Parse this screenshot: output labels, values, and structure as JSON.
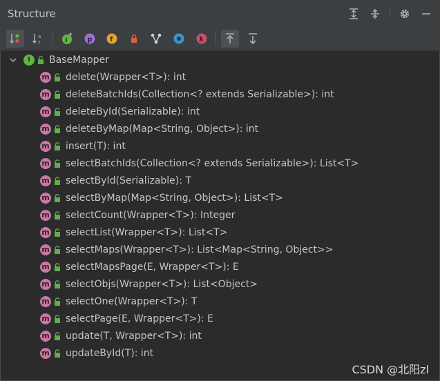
{
  "panel": {
    "title": "Structure"
  },
  "titlebar_icons": [
    "expand-all-icon",
    "collapse-all-icon",
    "gear-icon",
    "minimize-icon"
  ],
  "toolbar": {
    "buttons": [
      {
        "name": "sort-by-visibility-icon",
        "active": true
      },
      {
        "name": "sort-alphabetically-icon",
        "active": false
      },
      {
        "name": "show-inherited-icon",
        "active": false
      },
      {
        "name": "show-properties-icon",
        "active": false
      },
      {
        "name": "show-fields-icon",
        "active": false
      },
      {
        "name": "show-non-public-icon",
        "active": false
      },
      {
        "name": "show-lambdas-tree-icon",
        "active": false
      },
      {
        "name": "show-anonymous-icon",
        "active": false
      },
      {
        "name": "show-lambdas-icon",
        "active": false
      },
      {
        "name": "autoscroll-to-source-icon",
        "active": true
      },
      {
        "name": "autoscroll-from-source-icon",
        "active": false
      }
    ]
  },
  "tree": {
    "root": {
      "label": "BaseMapper",
      "kind": "interface"
    },
    "methods": [
      "delete(Wrapper<T>): int",
      "deleteBatchIds(Collection<? extends Serializable>): int",
      "deleteById(Serializable): int",
      "deleteByMap(Map<String, Object>): int",
      "insert(T): int",
      "selectBatchIds(Collection<? extends Serializable>): List<T>",
      "selectById(Serializable): T",
      "selectByMap(Map<String, Object>): List<T>",
      "selectCount(Wrapper<T>): Integer",
      "selectList(Wrapper<T>): List<T>",
      "selectMaps(Wrapper<T>): List<Map<String, Object>>",
      "selectMapsPage(E, Wrapper<T>): E",
      "selectObjs(Wrapper<T>): List<Object>",
      "selectOne(Wrapper<T>): T",
      "selectPage(E, Wrapper<T>): E",
      "update(T, Wrapper<T>): int",
      "updateById(T): int"
    ]
  },
  "watermark": "CSDN @北阳zl",
  "colors": {
    "method_badge": "#c77aa0",
    "interface_badge": "#62b543",
    "lock": "#5fae4c"
  }
}
